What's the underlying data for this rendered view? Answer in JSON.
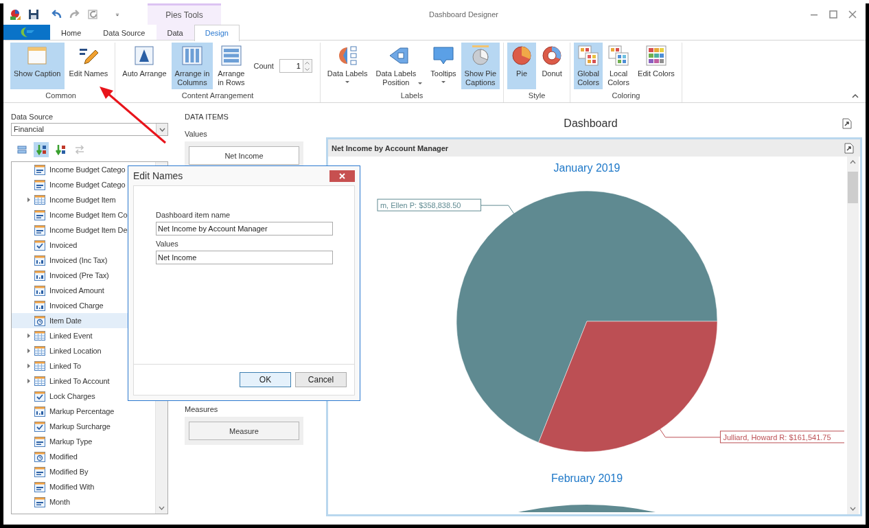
{
  "title_bar": {
    "context_tab_group": "Pies Tools",
    "title": "Dashboard Designer"
  },
  "tabs": [
    {
      "label": "Home",
      "selected": false,
      "contextual": false
    },
    {
      "label": "Data Source",
      "selected": false,
      "contextual": false
    },
    {
      "label": "Data",
      "selected": false,
      "contextual": true
    },
    {
      "label": "Design",
      "selected": true,
      "contextual": true
    }
  ],
  "ribbon": {
    "groups": [
      {
        "label": "Common",
        "items": [
          {
            "kind": "button",
            "label": "Show Caption",
            "selected": true,
            "dropdown": false
          },
          {
            "kind": "button",
            "label": "Edit Names",
            "selected": false,
            "dropdown": false
          }
        ]
      },
      {
        "label": "Content Arrangement",
        "items": [
          {
            "kind": "button",
            "label": "Auto Arrange",
            "selected": false,
            "dropdown": false
          },
          {
            "kind": "button",
            "label": "Arrange in\nColumns",
            "selected": true,
            "dropdown": false
          },
          {
            "kind": "button",
            "label": "Arrange\nin Rows",
            "selected": false,
            "dropdown": false
          },
          {
            "kind": "spinner",
            "label": "Count",
            "value": "1"
          }
        ]
      },
      {
        "label": "Labels",
        "items": [
          {
            "kind": "button",
            "label": "Data Labels",
            "selected": false,
            "dropdown": true
          },
          {
            "kind": "button",
            "label": "Data Labels\nPosition",
            "selected": false,
            "dropdown": true
          },
          {
            "kind": "button",
            "label": "Tooltips",
            "selected": false,
            "dropdown": true
          },
          {
            "kind": "button",
            "label": "Show Pie\nCaptions",
            "selected": true,
            "dropdown": false
          }
        ]
      },
      {
        "label": "Style",
        "items": [
          {
            "kind": "button",
            "label": "Pie",
            "selected": true,
            "dropdown": false
          },
          {
            "kind": "button",
            "label": "Donut",
            "selected": false,
            "dropdown": false
          }
        ]
      },
      {
        "label": "Coloring",
        "items": [
          {
            "kind": "button",
            "label": "Global\nColors",
            "selected": true,
            "dropdown": false
          },
          {
            "kind": "button",
            "label": "Local\nColors",
            "selected": false,
            "dropdown": false
          },
          {
            "kind": "button",
            "label": "Edit Colors",
            "selected": false,
            "dropdown": false
          }
        ]
      }
    ]
  },
  "data_source": {
    "label": "Data Source",
    "value": "Financial",
    "toolbar": [
      {
        "selected": false,
        "disabled": false
      },
      {
        "selected": true,
        "disabled": false
      },
      {
        "selected": false,
        "disabled": false
      },
      {
        "selected": false,
        "disabled": true
      }
    ],
    "fields": [
      {
        "label": "Income Budget Catego",
        "kind": "text",
        "expandable": false,
        "selected": false
      },
      {
        "label": "Income Budget Catego",
        "kind": "text",
        "expandable": false,
        "selected": false
      },
      {
        "label": "Income Budget Item",
        "kind": "table",
        "expandable": true,
        "selected": false
      },
      {
        "label": "Income Budget Item Co",
        "kind": "text",
        "expandable": false,
        "selected": false
      },
      {
        "label": "Income Budget Item De",
        "kind": "text",
        "expandable": false,
        "selected": false
      },
      {
        "label": "Invoiced",
        "kind": "bool",
        "expandable": false,
        "selected": false
      },
      {
        "label": "Invoiced (Inc Tax)",
        "kind": "number",
        "expandable": false,
        "selected": false
      },
      {
        "label": "Invoiced (Pre Tax)",
        "kind": "number",
        "expandable": false,
        "selected": false
      },
      {
        "label": "Invoiced Amount",
        "kind": "number",
        "expandable": false,
        "selected": false
      },
      {
        "label": "Invoiced Charge",
        "kind": "number",
        "expandable": false,
        "selected": false
      },
      {
        "label": "Item Date",
        "kind": "date",
        "expandable": false,
        "selected": true
      },
      {
        "label": "Linked Event",
        "kind": "table",
        "expandable": true,
        "selected": false
      },
      {
        "label": "Linked Location",
        "kind": "table",
        "expandable": true,
        "selected": false
      },
      {
        "label": "Linked To",
        "kind": "table",
        "expandable": true,
        "selected": false
      },
      {
        "label": "Linked To Account",
        "kind": "table",
        "expandable": true,
        "selected": false
      },
      {
        "label": "Lock Charges",
        "kind": "bool",
        "expandable": false,
        "selected": false
      },
      {
        "label": "Markup Percentage",
        "kind": "number",
        "expandable": false,
        "selected": false
      },
      {
        "label": "Markup Surcharge",
        "kind": "bool",
        "expandable": false,
        "selected": false
      },
      {
        "label": "Markup Type",
        "kind": "text",
        "expandable": false,
        "selected": false
      },
      {
        "label": "Modified",
        "kind": "date",
        "expandable": false,
        "selected": false
      },
      {
        "label": "Modified By",
        "kind": "text",
        "expandable": false,
        "selected": false
      },
      {
        "label": "Modified With",
        "kind": "text",
        "expandable": false,
        "selected": false
      },
      {
        "label": "Month",
        "kind": "text",
        "expandable": false,
        "selected": false
      }
    ]
  },
  "data_items": {
    "heading": "DATA ITEMS",
    "sections": [
      {
        "label": "Values",
        "items": [
          "Net Income"
        ]
      },
      {
        "label": "Measures",
        "items": [
          "Measure"
        ]
      }
    ]
  },
  "dashboard": {
    "title": "Dashboard",
    "item": {
      "caption": "Net Income by Account Manager",
      "chart_data": {
        "type": "pie",
        "title": "January 2019",
        "values": [
          358838.5,
          161541.75
        ],
        "value_labels": [
          "m, Ellen P: $358,838.50",
          "Julliard, Howard R: $161,541.75"
        ]
      },
      "next_pie_title": "February 2019"
    }
  },
  "dialog": {
    "title": "Edit Names",
    "fields": [
      {
        "label": "Dashboard item name",
        "value": "Net Income by Account Manager"
      },
      {
        "label": "Values",
        "value": "Net Income"
      }
    ],
    "buttons": [
      {
        "label": "OK",
        "default": true
      },
      {
        "label": "Cancel",
        "default": false
      }
    ]
  }
}
